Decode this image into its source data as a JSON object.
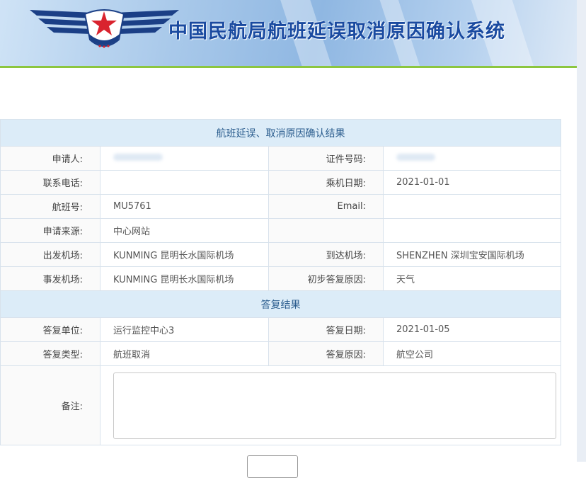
{
  "header": {
    "system_title": "中国民航局航班延误取消原因确认系统",
    "logo_icon": "caac-wings-star-logo"
  },
  "colors": {
    "title": "#1a4aa0",
    "section_bg": "#dcecf8",
    "section_text": "#2b5d8e",
    "accent_line": "#8cc63f",
    "star": "#d9232e"
  },
  "section1": {
    "title": "航班延误、取消原因确认结果",
    "applicant_label": "申请人:",
    "applicant_value": "",
    "id_label": "证件号码:",
    "id_value": "",
    "phone_label": "联系电话:",
    "phone_value": "",
    "date_label": "乘机日期:",
    "date_value": "2021-01-01",
    "flight_label": "航班号:",
    "flight_value": "MU5761",
    "email_label": "Email:",
    "email_value": "",
    "source_label": "申请来源:",
    "source_value": "中心网站",
    "dep_label": "出发机场:",
    "dep_value": "KUNMING 昆明长水国际机场",
    "arr_label": "到达机场:",
    "arr_value": "SHENZHEN 深圳宝安国际机场",
    "incident_label": "事发机场:",
    "incident_value": "KUNMING 昆明长水国际机场",
    "initial_reason_label": "初步答复原因:",
    "initial_reason_value": "天气"
  },
  "section2": {
    "title": "答复结果",
    "unit_label": "答复单位:",
    "unit_value": "运行监控中心3",
    "reply_date_label": "答复日期:",
    "reply_date_value": "2021-01-05",
    "type_label": "答复类型:",
    "type_value": "航班取消",
    "reason_label": "答复原因:",
    "reason_value": "航空公司",
    "remark_label": "备注:",
    "remark_value": ""
  }
}
